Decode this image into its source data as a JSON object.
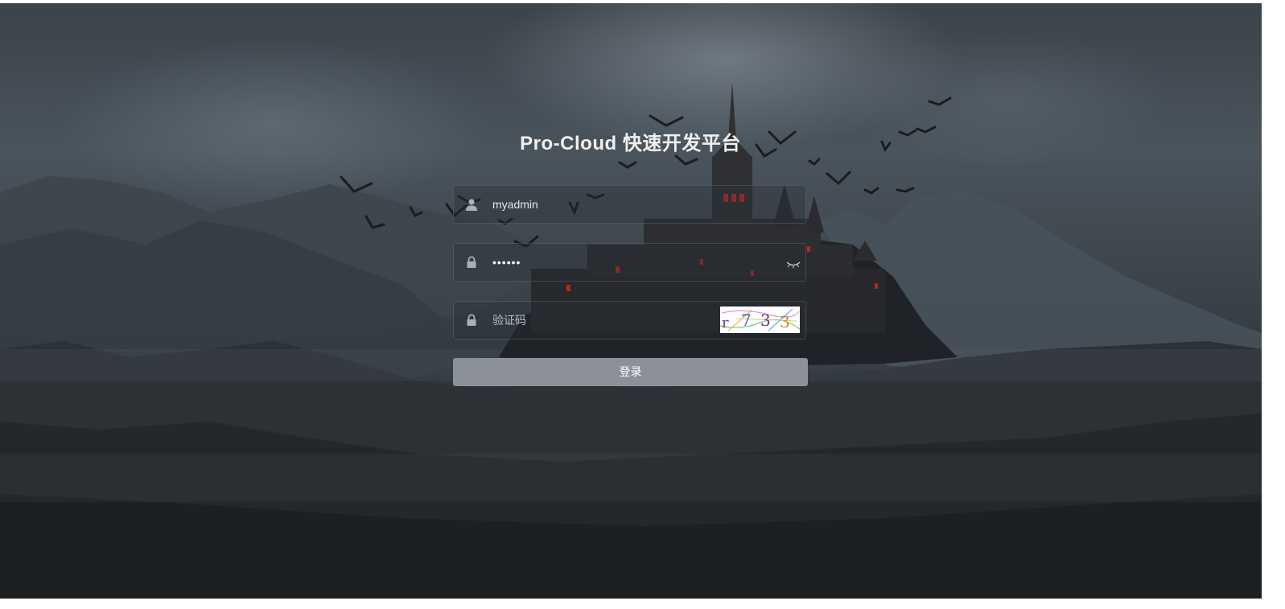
{
  "title": "Pro-Cloud 快速开发平台",
  "form": {
    "username": {
      "value": "myadmin",
      "icon": "user-icon"
    },
    "password": {
      "masked_value": "••••••",
      "icon": "lock-icon",
      "toggle_icon": "eye-closed-icon"
    },
    "captcha": {
      "placeholder": "验证码",
      "icon": "lock-icon",
      "image_text": "r 7 3 3"
    },
    "submit_label": "登录"
  },
  "colors": {
    "title": "#f0f0f0",
    "button_bg": "#8c9097",
    "field_text": "#e6e6e6",
    "placeholder": "#b9bec3"
  }
}
